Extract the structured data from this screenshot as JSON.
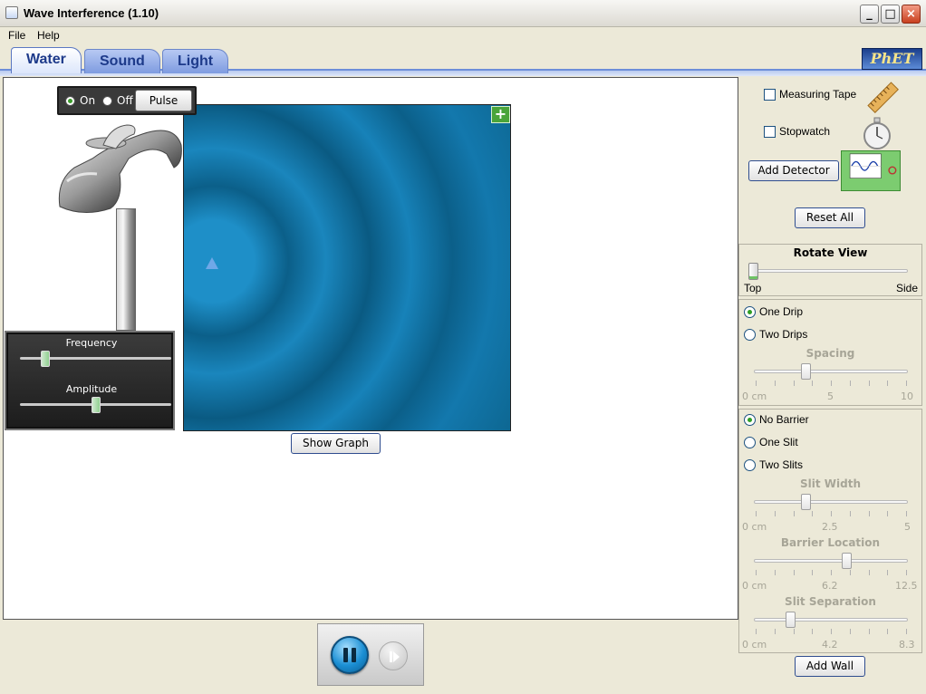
{
  "window": {
    "title": "Wave Interference (1.10)"
  },
  "menu": {
    "file": "File",
    "help": "Help"
  },
  "tabs": [
    {
      "label": "Water"
    },
    {
      "label": "Sound"
    },
    {
      "label": "Light"
    }
  ],
  "active_tab": "Water",
  "logo": {
    "text": "PhET"
  },
  "faucet": {
    "on_label": "On",
    "off_label": "Off",
    "pulse_label": "Pulse",
    "selected": "On"
  },
  "controls": {
    "frequency_label": "Frequency",
    "frequency_level": 0.17,
    "amplitude_label": "Amplitude",
    "amplitude_level": 0.5
  },
  "show_graph_label": "Show Graph",
  "tools": {
    "measuring_tape_label": "Measuring Tape",
    "stopwatch_label": "Stopwatch",
    "add_detector_label": "Add Detector",
    "reset_all_label": "Reset All"
  },
  "rotate_view": {
    "title": "Rotate View",
    "min_label": "Top",
    "max_label": "Side",
    "value": 0
  },
  "drips": {
    "one_drip_label": "One Drip",
    "two_drips_label": "Two Drips",
    "selected": "One Drip",
    "spacing": {
      "title": "Spacing",
      "min": "0 cm",
      "mid": "5",
      "max": "10",
      "value": 3.4
    }
  },
  "barrier": {
    "no_barrier_label": "No Barrier",
    "one_slit_label": "One Slit",
    "two_slits_label": "Two Slits",
    "selected": "No Barrier",
    "slit_width": {
      "title": "Slit Width",
      "min": "0 cm",
      "mid": "2.5",
      "max": "5",
      "value": 1.7
    },
    "barrier_location": {
      "title": "Barrier Location",
      "min": "0 cm",
      "mid": "6.2",
      "max": "12.5",
      "value": 7.6
    },
    "slit_separation": {
      "title": "Slit Separation",
      "min": "0 cm",
      "mid": "4.2",
      "max": "8.3",
      "value": 2.0
    }
  },
  "add_wall_label": "Add Wall",
  "colors": {
    "water": "#0d6792",
    "panel_bg": "#ece9d8",
    "tab_active": "#dce6fb",
    "selected_radio": "#2e9e25"
  }
}
